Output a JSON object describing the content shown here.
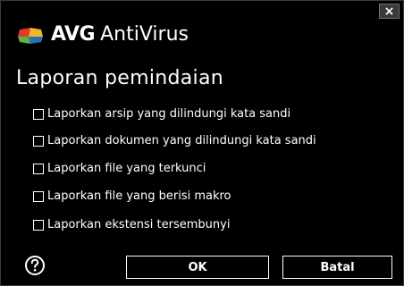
{
  "window": {
    "brand_bold": "AVG",
    "brand_light": "AntiVirus",
    "close_label": "×"
  },
  "heading": "Laporan pemindaian",
  "options": [
    {
      "label": "Laporkan arsip yang dilindungi kata sandi",
      "checked": false
    },
    {
      "label": "Laporkan dokumen yang dilindungi kata sandi",
      "checked": false
    },
    {
      "label": "Laporkan file yang terkunci",
      "checked": false
    },
    {
      "label": "Laporkan file yang berisi makro",
      "checked": false
    },
    {
      "label": "Laporkan ekstensi tersembunyi",
      "checked": false
    }
  ],
  "buttons": {
    "ok": "OK",
    "cancel": "Batal"
  },
  "icons": {
    "help": "help-icon",
    "logo": "avg-logo-icon",
    "close": "close-icon"
  },
  "colors": {
    "background": "#000000",
    "text": "#ffffff",
    "logo_red": "#e03a2c",
    "logo_yellow": "#f5b72a",
    "logo_green": "#5ab443",
    "logo_blue": "#2a6fb8"
  }
}
